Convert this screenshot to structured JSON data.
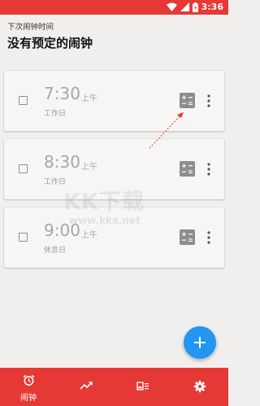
{
  "status_bar": {
    "time": "3:36"
  },
  "header": {
    "subtitle": "下次闹钟时间",
    "title": "没有预定的闹钟"
  },
  "alarms": [
    {
      "time": "7:30",
      "ampm": "上午",
      "days": "工作日"
    },
    {
      "time": "8:30",
      "ampm": "上午",
      "days": "工作日"
    },
    {
      "time": "9:00",
      "ampm": "上午",
      "days": "休息日"
    }
  ],
  "bottom_nav": {
    "alarm_label": "闹钟"
  },
  "watermark": {
    "text": "KK下载",
    "url": "www.kkx.net"
  },
  "colors": {
    "accent": "#e53935",
    "fab": "#2196f3"
  }
}
